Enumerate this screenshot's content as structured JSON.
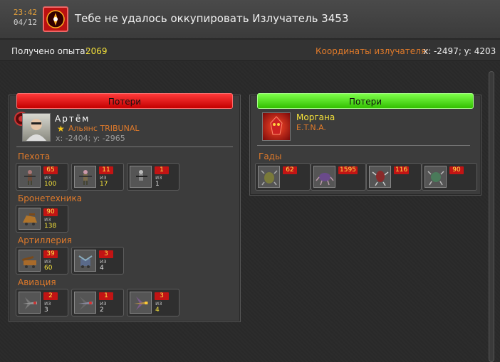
{
  "header": {
    "time": "23:42",
    "date": "04/12",
    "icon": "radiator-alert-icon",
    "title": "Тебе не удалось оккупировать Излучатель 3453"
  },
  "infobar": {
    "exp_label": "Получено опыта:",
    "exp_value": "2069",
    "coord_label": "Координаты излучателя:",
    "coord_value": "x: -2497; y: 4203"
  },
  "left": {
    "bar_label": "Потери",
    "player_name": "Артём",
    "alliance": "Альянс TRIBUNAL",
    "coords": "x: -2404; y: -2965",
    "sections": [
      {
        "title": "Пехота",
        "units": [
          {
            "icon": "infantry-icon",
            "lost": "65",
            "of": "из",
            "total": "100"
          },
          {
            "icon": "infantry-icon",
            "lost": "11",
            "of": "из",
            "total": "17"
          },
          {
            "icon": "infantry-icon",
            "lost": "1",
            "of": "из",
            "total": "1"
          }
        ]
      },
      {
        "title": "Бронетехника",
        "units": [
          {
            "icon": "armor-icon",
            "lost": "90",
            "of": "из",
            "total": "138"
          }
        ]
      },
      {
        "title": "Артиллерия",
        "units": [
          {
            "icon": "artillery-icon",
            "lost": "39",
            "of": "из",
            "total": "60"
          },
          {
            "icon": "artillery-icon",
            "lost": "3",
            "of": "из",
            "total": "4"
          }
        ]
      },
      {
        "title": "Авиация",
        "units": [
          {
            "icon": "aircraft-icon",
            "lost": "2",
            "of": "из",
            "total": "3"
          },
          {
            "icon": "aircraft-icon",
            "lost": "1",
            "of": "из",
            "total": "2"
          },
          {
            "icon": "aircraft-icon",
            "lost": "3",
            "of": "из",
            "total": "4"
          }
        ]
      }
    ]
  },
  "right": {
    "bar_label": "Потери",
    "player_name": "Моргана",
    "alliance": "E.T.N.A.",
    "section_title": "Гады",
    "units": [
      {
        "icon": "creature-icon",
        "lost": "62"
      },
      {
        "icon": "creature-icon",
        "lost": "1595"
      },
      {
        "icon": "creature-icon",
        "lost": "116"
      },
      {
        "icon": "creature-icon",
        "lost": "90"
      }
    ]
  }
}
